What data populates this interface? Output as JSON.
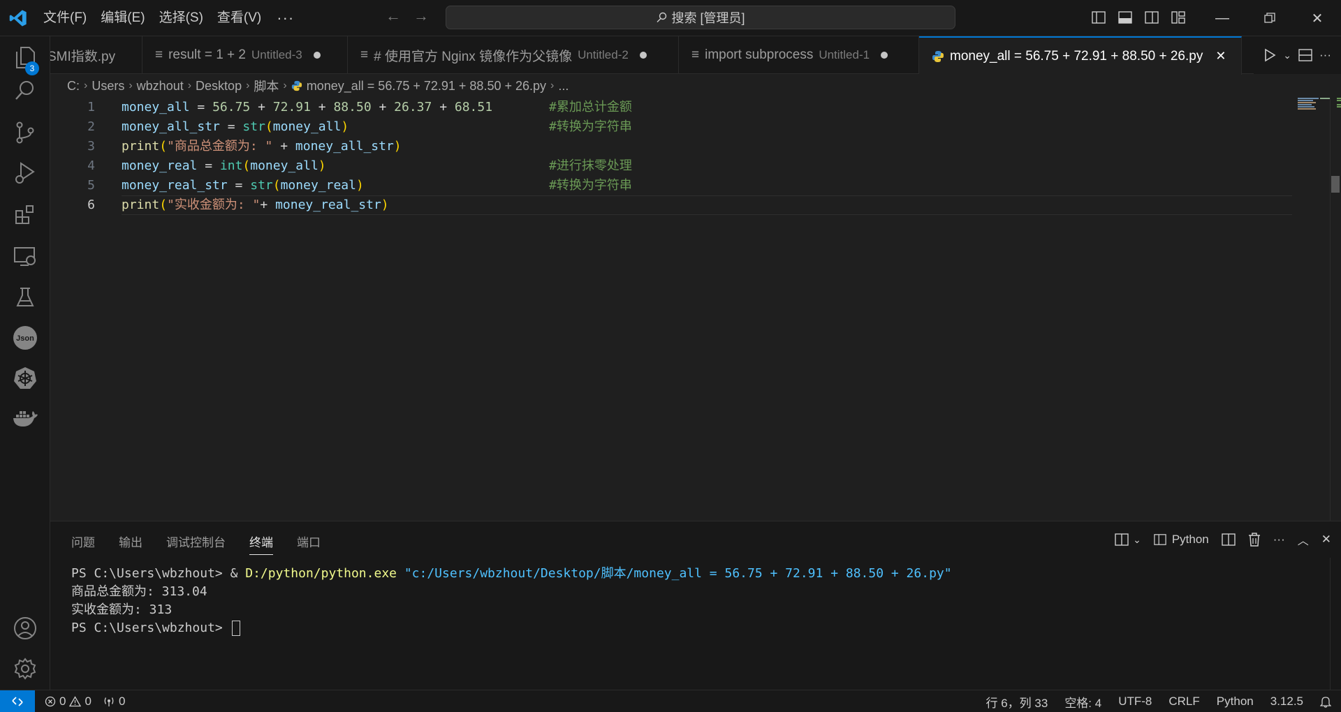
{
  "titlebar": {
    "menus": [
      "文件(F)",
      "编辑(E)",
      "选择(S)",
      "查看(V)"
    ],
    "more": "···",
    "search": "搜索 [管理员]"
  },
  "activitybar": {
    "explorer_badge": "3"
  },
  "tabs": [
    {
      "title": "SMI指数.py",
      "desc": "",
      "dirty": false
    },
    {
      "title": "result = 1 + 2",
      "desc": "Untitled-3",
      "dirty": true
    },
    {
      "title": "# 使用官方 Nginx 镜像作为父镜像",
      "desc": "Untitled-2",
      "dirty": true
    },
    {
      "title": "import subprocess",
      "desc": "Untitled-1",
      "dirty": true
    },
    {
      "title": "money_all = 56.75 + 72.91 + 88.50 + 26.py",
      "desc": "",
      "active": true
    }
  ],
  "breadcrumb": [
    "C:",
    "Users",
    "wbzhout",
    "Desktop",
    "脚本",
    "money_all = 56.75 + 72.91 + 88.50 + 26.py",
    "..."
  ],
  "editor": {
    "line_numbers": [
      "1",
      "2",
      "3",
      "4",
      "5",
      "6"
    ],
    "lines": [
      {
        "tokens": [
          [
            "var",
            "money_all"
          ],
          [
            "op",
            " = "
          ],
          [
            "num",
            "56.75"
          ],
          [
            "op",
            " + "
          ],
          [
            "num",
            "72.91"
          ],
          [
            "op",
            " + "
          ],
          [
            "num",
            "88.50"
          ],
          [
            "op",
            " + "
          ],
          [
            "num",
            "26.37"
          ],
          [
            "op",
            " + "
          ],
          [
            "num",
            "68.51"
          ]
        ],
        "comment": "#累加总计金额"
      },
      {
        "tokens": [
          [
            "var",
            "money_all_str"
          ],
          [
            "op",
            " = "
          ],
          [
            "kw-builtin",
            "str"
          ],
          [
            "paren",
            "("
          ],
          [
            "var",
            "money_all"
          ],
          [
            "paren",
            ")"
          ]
        ],
        "comment": "#转换为字符串"
      },
      {
        "tokens": [
          [
            "kw-fn",
            "print"
          ],
          [
            "paren",
            "("
          ],
          [
            "str",
            "\"商品总金额为: \""
          ],
          [
            "op",
            " + "
          ],
          [
            "var",
            "money_all_str"
          ],
          [
            "paren",
            ")"
          ]
        ],
        "comment": ""
      },
      {
        "tokens": [
          [
            "var",
            "money_real"
          ],
          [
            "op",
            " = "
          ],
          [
            "kw-builtin",
            "int"
          ],
          [
            "paren",
            "("
          ],
          [
            "var",
            "money_all"
          ],
          [
            "paren",
            ")"
          ]
        ],
        "comment": "#进行抹零处理"
      },
      {
        "tokens": [
          [
            "var",
            "money_real_str"
          ],
          [
            "op",
            " = "
          ],
          [
            "kw-builtin",
            "str"
          ],
          [
            "paren",
            "("
          ],
          [
            "var",
            "money_real"
          ],
          [
            "paren",
            ")"
          ]
        ],
        "comment": "#转换为字符串"
      },
      {
        "tokens": [
          [
            "kw-fn",
            "print"
          ],
          [
            "paren",
            "("
          ],
          [
            "str",
            "\"实收金额为: \""
          ],
          [
            "op",
            "+ "
          ],
          [
            "var",
            "money_real_str"
          ],
          [
            "paren",
            ")"
          ]
        ],
        "comment": ""
      }
    ]
  },
  "panel": {
    "tabs": [
      "问题",
      "输出",
      "调试控制台",
      "终端",
      "端口"
    ],
    "active_tab": "终端",
    "shell_label": "Python",
    "terminal": {
      "cmd_prompt": "PS C:\\Users\\wbzhout> & ",
      "cmd_exe": "D:/python/python.exe",
      "cmd_arg": " \"c:/Users/wbzhout/Desktop/脚本/money_all = 56.75 + 72.91 + 88.50 + 26.py\"",
      "out1": "商品总金额为: 313.04",
      "out2": "实收金额为: 313",
      "prompt": "PS C:\\Users\\wbzhout> "
    }
  },
  "statusbar": {
    "errors": "0",
    "warnings": "0",
    "ports": "0",
    "position": "行 6，列 33",
    "spaces": "空格: 4",
    "encoding": "UTF-8",
    "eol": "CRLF",
    "language": "Python",
    "version": "3.12.5"
  },
  "colors": {
    "accent": "#0078d4",
    "comment": "#6a9955",
    "string": "#ce9178",
    "number": "#b5cea8"
  }
}
